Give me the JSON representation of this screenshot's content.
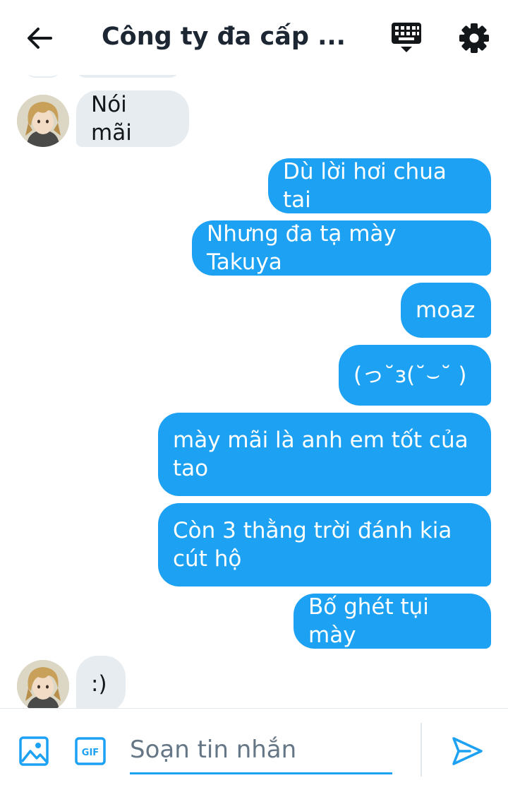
{
  "header": {
    "title": "Công ty đa cấp ...",
    "back_icon": "arrow-left-icon",
    "keyboard_icon": "keyboard-icon",
    "settings_icon": "gear-icon"
  },
  "messages": [
    {
      "direction": "in",
      "text": "Nói mãi",
      "avatar": "avatar"
    },
    {
      "direction": "out",
      "text": "Dù lời hơi chua tai"
    },
    {
      "direction": "out",
      "text": "Nhưng đa tạ mày Takuya"
    },
    {
      "direction": "out",
      "text": "moaz"
    },
    {
      "direction": "out",
      "text": "(っ˘з(˘⌣˘ )"
    },
    {
      "direction": "out",
      "text": "mày mãi là anh em tốt của tao"
    },
    {
      "direction": "out",
      "text": "Còn 3 thằng trời đánh kia cút hộ"
    },
    {
      "direction": "out",
      "text": "Bố ghét tụi mày"
    },
    {
      "direction": "in",
      "text": ":)",
      "avatar": "avatar"
    }
  ],
  "composer": {
    "placeholder": "Soạn tin nhắn",
    "image_icon": "image-icon",
    "gif_label": "GIF",
    "send_icon": "send-icon"
  },
  "colors": {
    "accent": "#1da1f2",
    "incoming_bubble": "#e6ecf0",
    "outgoing_bubble": "#1da1f2"
  }
}
